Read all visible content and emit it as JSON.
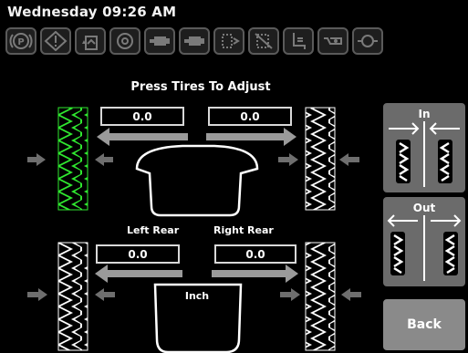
{
  "header": {
    "datetime": "Wednesday 09:26 AM"
  },
  "indicators": [
    {
      "icon": "parking-brake-icon"
    },
    {
      "icon": "warning-diamond-icon"
    },
    {
      "icon": "fuel-water-icon"
    },
    {
      "icon": "engine-icon"
    },
    {
      "icon": "transmission-icon"
    },
    {
      "icon": "transmission-temp-icon"
    },
    {
      "icon": "filter-icon"
    },
    {
      "icon": "filter-off-icon"
    },
    {
      "icon": "seat-icon"
    },
    {
      "icon": "oil-level-icon"
    },
    {
      "icon": "oil-pressure-icon"
    }
  ],
  "main": {
    "title": "Press Tires To Adjust",
    "front_left_value": "0.0",
    "front_right_value": "0.0",
    "rear_left_label": "Left Rear",
    "rear_right_label": "Right Rear",
    "rear_left_value": "0.0",
    "rear_right_value": "0.0",
    "unit": "Inch",
    "selected_tire": "front-left"
  },
  "side": {
    "in_label": "In",
    "out_label": "Out",
    "back_label": "Back"
  },
  "colors": {
    "selected": "#2fe82f",
    "unselected": "#ffffff",
    "arrow": "#9a9a9a",
    "button": "#6b6b6b"
  }
}
